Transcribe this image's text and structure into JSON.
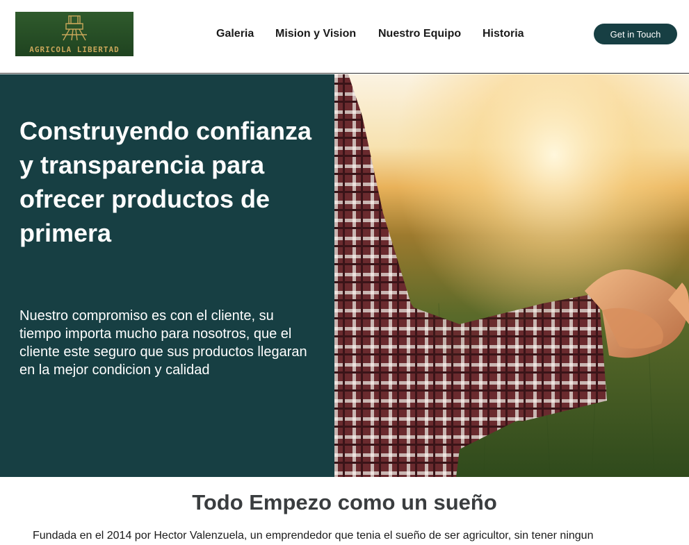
{
  "brand": {
    "logo_text": "AGRICOLA LIBERTAD"
  },
  "nav": {
    "items": [
      {
        "label": "Galeria"
      },
      {
        "label": "Mision y Vision"
      },
      {
        "label": "Nuestro Equipo"
      },
      {
        "label": "Historia"
      }
    ],
    "cta_label": "Get in Touch"
  },
  "hero": {
    "title": "Construyendo confianza y transparencia para ofrecer productos de primera",
    "body": "Nuestro compromiso es con el cliente, su tiempo importa mucho para nosotros, que el cliente este seguro que sus productos llegaran en la mejor condicion y calidad",
    "image": "handshake-photo"
  },
  "story": {
    "title": "Todo Empezo como un sueño",
    "text": "Fundada en el 2014 por Hector Valenzuela, un emprendedor que tenia el sueño de ser agricultor, sin tener ningun"
  },
  "colors": {
    "primary": "#173f43",
    "logo_bg": "#2f5a2c",
    "logo_gold": "#c9a75a"
  }
}
